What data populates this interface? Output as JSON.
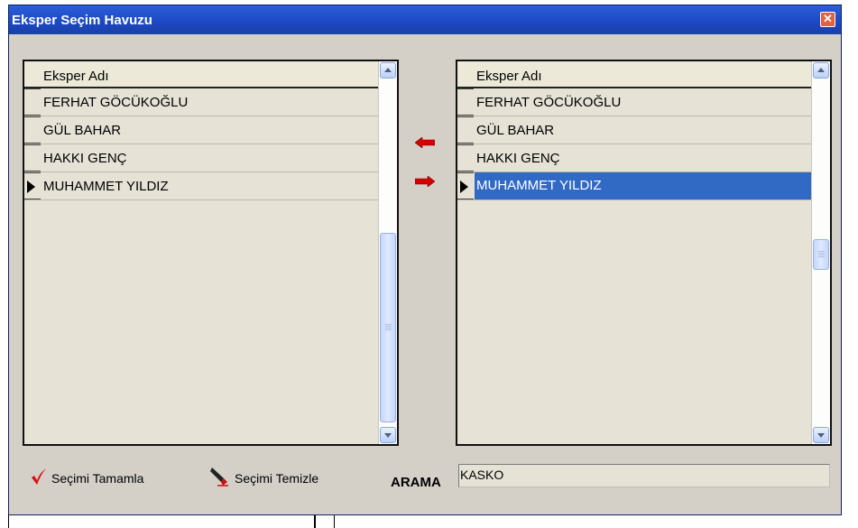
{
  "window": {
    "title": "Eksper Seçim Havuzu",
    "close_glyph": "✕"
  },
  "left_grid": {
    "header": "Eksper Adı",
    "rows": [
      "FERHAT GÖCÜKOĞLU",
      "GÜL BAHAR",
      "HAKKI GENÇ",
      "MUHAMMET YILDIZ"
    ],
    "current_row_index": 3
  },
  "right_grid": {
    "header": "Eksper Adı",
    "rows": [
      "FERHAT GÖCÜKOĞLU",
      "GÜL BAHAR",
      "HAKKI GENÇ",
      "MUHAMMET YILDIZ"
    ],
    "current_row_index": 3,
    "selected_row_index": 3
  },
  "transfer": {
    "left_icon": "arrow-left-icon",
    "right_icon": "arrow-right-icon",
    "arrow_color": "#d40000"
  },
  "footer": {
    "complete_label": "Seçimi Tamamla",
    "complete_icon": "checkmark-icon",
    "clear_label": "Seçimi Temizle",
    "clear_icon": "eraser-icon",
    "search_label": "ARAMA",
    "search_value": "KASKO"
  },
  "colors": {
    "titlebar": "#1d49c4",
    "selection": "#316ac5",
    "dialog_bg": "#d4d0c8",
    "grid_bg": "#e6e2d6"
  }
}
